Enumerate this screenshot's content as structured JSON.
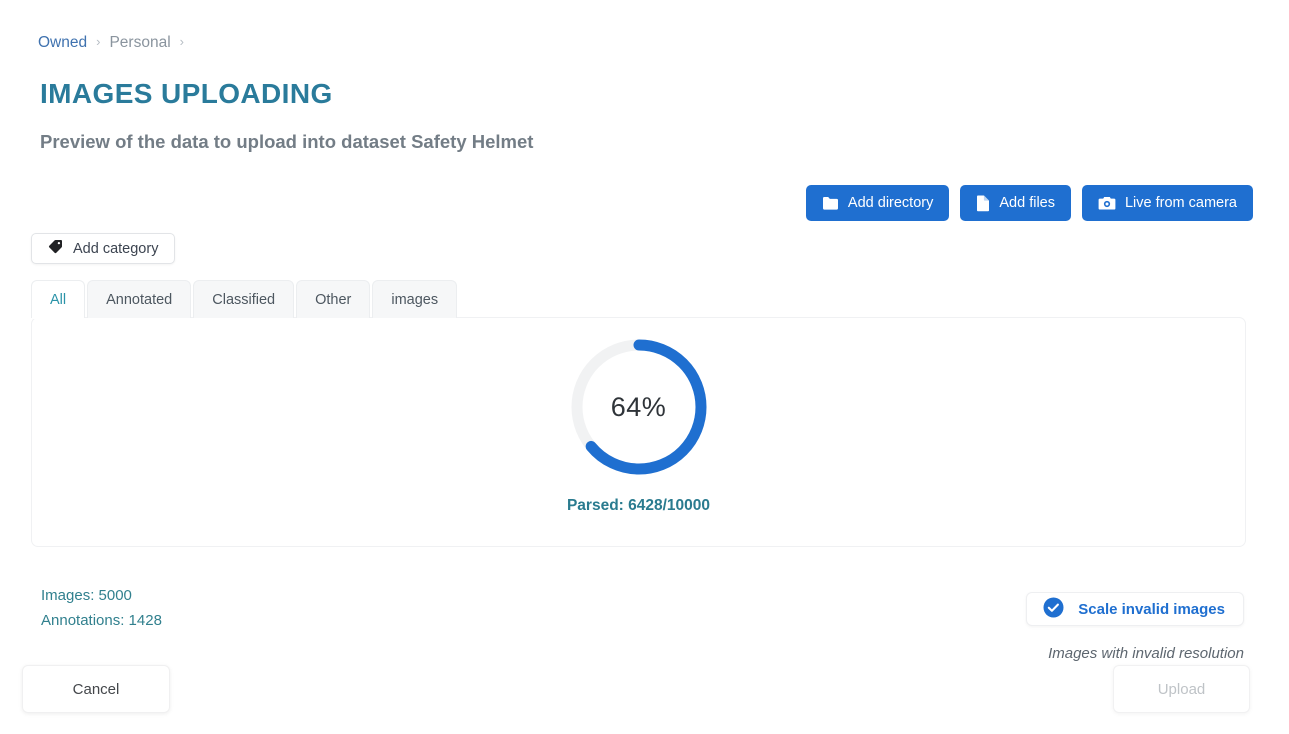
{
  "breadcrumb": {
    "items": [
      {
        "label": "Owned",
        "type": "link"
      },
      {
        "label": "Personal",
        "type": "current"
      }
    ],
    "separator": "›"
  },
  "header": {
    "title": "IMAGES UPLOADING",
    "subtitle": "Preview of the data to upload into dataset Safety Helmet"
  },
  "top_actions": [
    {
      "label": "Add directory",
      "icon": "folder-icon"
    },
    {
      "label": "Add files",
      "icon": "file-icon"
    },
    {
      "label": "Live from camera",
      "icon": "camera-icon"
    }
  ],
  "category": {
    "add_label": "Add category",
    "icon": "tag-icon"
  },
  "tabs": [
    {
      "label": "All",
      "active": true
    },
    {
      "label": "Annotated",
      "active": false
    },
    {
      "label": "Classified",
      "active": false
    },
    {
      "label": "Other",
      "active": false
    },
    {
      "label": "images",
      "active": false
    }
  ],
  "progress": {
    "percent_label": "64%",
    "percent_value": 64,
    "parsed_label": "Parsed: 6428/10000",
    "parsed_current": 6428,
    "parsed_total": 10000,
    "arc_color": "#1f6fd0",
    "track_color": "#f1f2f3"
  },
  "stats": {
    "images": "Images: 5000",
    "annotations": "Annotations: 1428"
  },
  "scale": {
    "label": "Scale invalid images",
    "icon": "check-circle-icon",
    "hint": "Images with invalid resolution",
    "enabled": true
  },
  "footer": {
    "cancel_label": "Cancel",
    "upload_label": "Upload",
    "upload_disabled": true
  },
  "colors": {
    "brand_teal": "#2a7b9b",
    "accent_blue": "#1f6fd0",
    "link_blue": "#3f72af",
    "muted": "#8a949e"
  }
}
